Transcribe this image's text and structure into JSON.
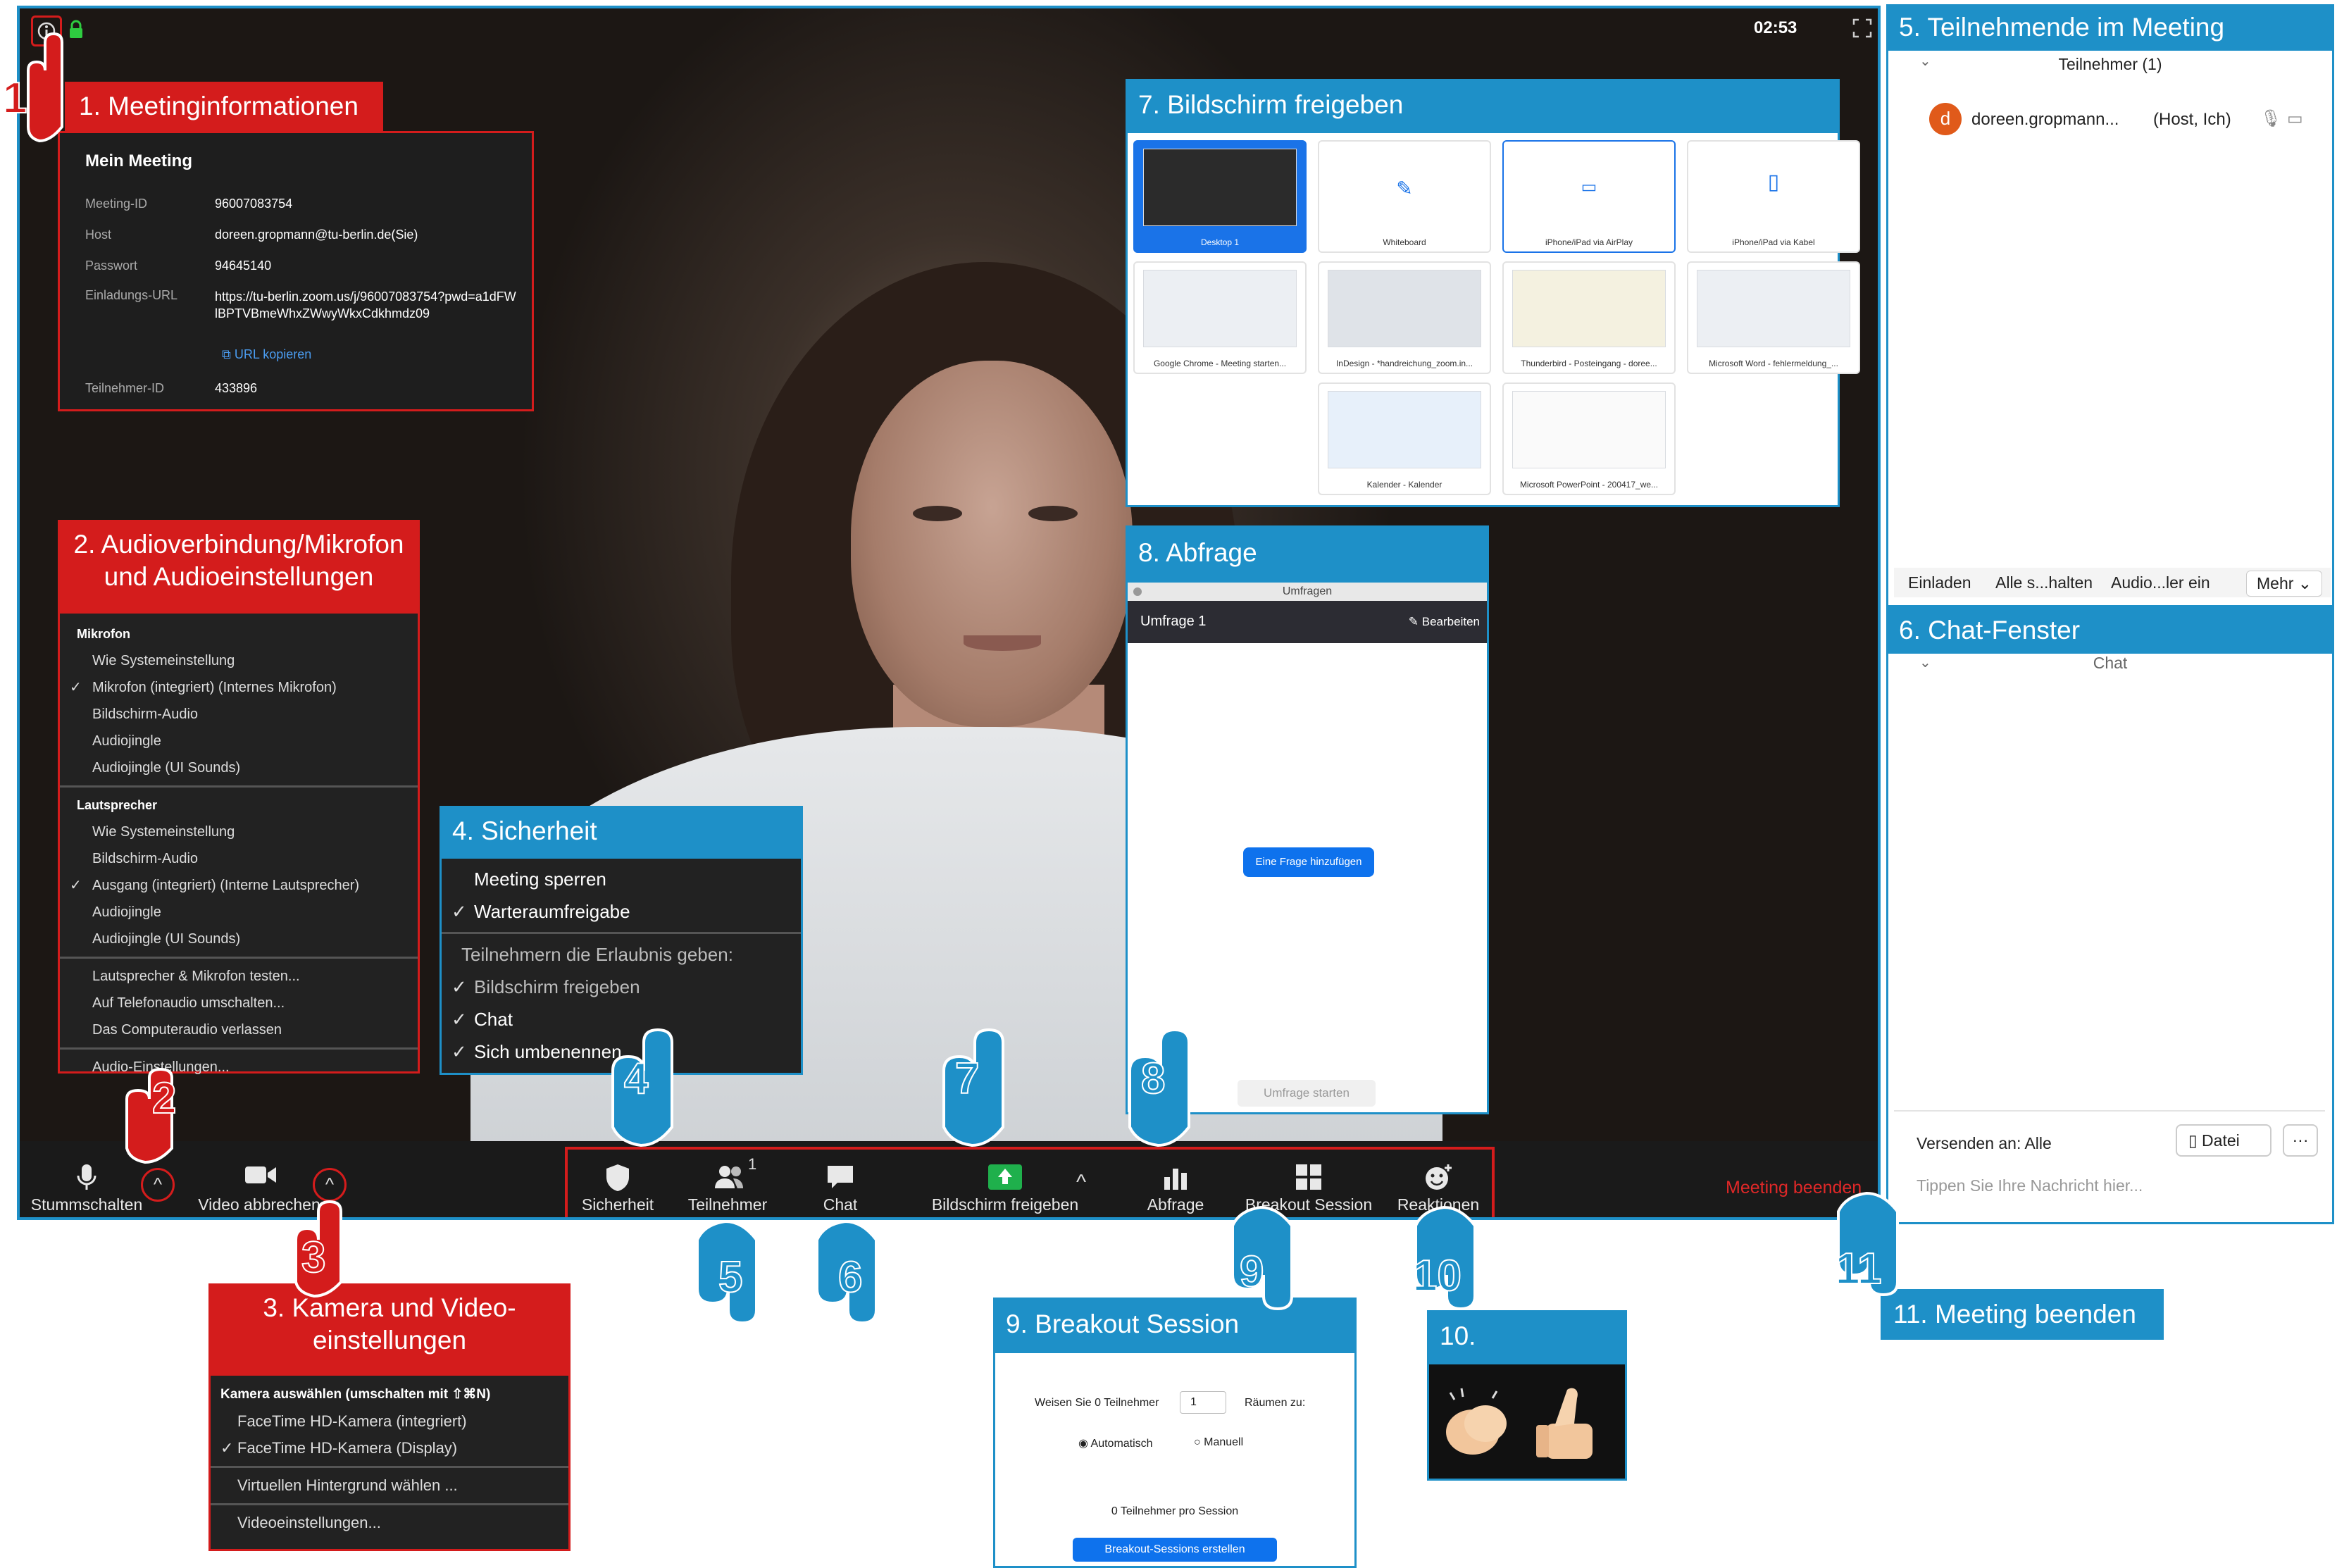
{
  "top": {
    "timer": "02:53"
  },
  "labels": {
    "l1": "1. Meetinginformationen",
    "l2": "2. Audioverbindung/Mikrofon und Audioeinstellungen",
    "l3": "3. Kamera und Video-einstellungen",
    "l4": "4. Sicherheit",
    "l5": "5. Teilnehmende im Meeting",
    "l6": "6. Chat-Fenster",
    "l7": "7. Bildschirm freigeben",
    "l8": "8. Abfrage",
    "l9": "9. Breakout Session",
    "l10": "10. Reaktionen",
    "l11": "11. Meeting beenden"
  },
  "numbers": [
    "1",
    "2",
    "3",
    "4",
    "5",
    "6",
    "7",
    "8",
    "9",
    "10",
    "11"
  ],
  "meeting_info": {
    "title": "Mein Meeting",
    "rows": [
      {
        "key": "Meeting-ID",
        "value": "96007083754"
      },
      {
        "key": "Host",
        "value": "doreen.gropmann@tu-berlin.de(Sie)"
      },
      {
        "key": "Passwort",
        "value": "94645140"
      },
      {
        "key": "Einladungs-URL",
        "value": "https://tu-berlin.zoom.us/j/96007083754?pwd=a1dFWlBPTVBmeWhxZWwyWkxCdkhmdz09"
      },
      {
        "key": "Teilnehmer-ID",
        "value": "433896"
      }
    ],
    "copy_link": "URL kopieren"
  },
  "audio_menu": {
    "mic_header": "Mikrofon",
    "mic_items": [
      "Wie Systemeinstellung",
      "Mikrofon (integriert) (Internes Mikrofon)",
      "Bildschirm-Audio",
      "Audiojingle",
      "Audiojingle (UI Sounds)"
    ],
    "spk_header": "Lautsprecher",
    "spk_items": [
      "Wie Systemeinstellung",
      "Bildschirm-Audio",
      "Ausgang (integriert) (Interne Lautsprecher)",
      "Audiojingle",
      "Audiojingle (UI Sounds)"
    ],
    "actions": [
      "Lautsprecher & Mikrofon testen...",
      "Auf Telefonaudio umschalten...",
      "Das Computeraudio verlassen"
    ],
    "settings": "Audio-Einstellungen..."
  },
  "security_menu": {
    "items": [
      "Meeting sperren",
      "Warteraumfreigabe"
    ],
    "allow_header": "Teilnehmern die Erlaubnis geben:",
    "allow_items": [
      "Bildschirm freigeben",
      "Chat",
      "Sich umbenennen"
    ]
  },
  "camera_menu": {
    "header": "Kamera auswählen (umschalten mit ⇧⌘N)",
    "items": [
      "FaceTime HD-Kamera (integriert)",
      "FaceTime HD-Kamera (Display)"
    ],
    "virtual_bg": "Virtuellen Hintergrund wählen ...",
    "settings": "Videoeinstellungen..."
  },
  "toolbar": {
    "mute": "Stummschalten",
    "video": "Video abbrechen",
    "security": "Sicherheit",
    "participants": "Teilnehmer",
    "participants_count": "1",
    "chat": "Chat",
    "share": "Bildschirm freigeben",
    "poll": "Abfrage",
    "breakout": "Breakout Session",
    "reactions": "Reaktionen",
    "end": "Meeting beenden"
  },
  "share_panel": {
    "items": [
      "Desktop 1",
      "Whiteboard",
      "iPhone/iPad via AirPlay",
      "iPhone/iPad via Kabel",
      "Google Chrome - Meeting starten...",
      "InDesign - *handreichung_zoom.in...",
      "Thunderbird - Posteingang - doree...",
      "Microsoft Word - fehlermeldung_...",
      "Kalender - Kalender",
      "Microsoft PowerPoint - 200417_we..."
    ]
  },
  "poll_panel": {
    "window_title": "Umfragen",
    "poll_name": "Umfrage 1",
    "edit": "Bearbeiten",
    "add_question": "Eine Frage hinzufügen",
    "start": "Umfrage starten"
  },
  "participants_panel": {
    "header": "Teilnehmer (1)",
    "avatar_letter": "d",
    "name": "doreen.gropmann...",
    "role": "(Host, Ich)",
    "buttons": [
      "Einladen",
      "Alle s...halten",
      "Audio...ler ein",
      "Mehr"
    ]
  },
  "chat_panel": {
    "header": "Chat",
    "send_to": "Versenden an: Alle",
    "file": "Datei",
    "more": "···",
    "placeholder": "Tippen Sie Ihre Nachricht hier..."
  },
  "breakout_panel": {
    "assign_pre": "Weisen Sie 0 Teilnehmer",
    "rooms_value": "1",
    "assign_post": "Räumen zu:",
    "auto": "Automatisch",
    "manual": "Manuell",
    "per_session": "0 Teilnehmer pro Session",
    "create": "Breakout-Sessions erstellen"
  },
  "colors": {
    "red": "#d41c1c",
    "blue": "#1e90c8",
    "green": "#1fb04c",
    "zoom_blue": "#0e72ed"
  }
}
